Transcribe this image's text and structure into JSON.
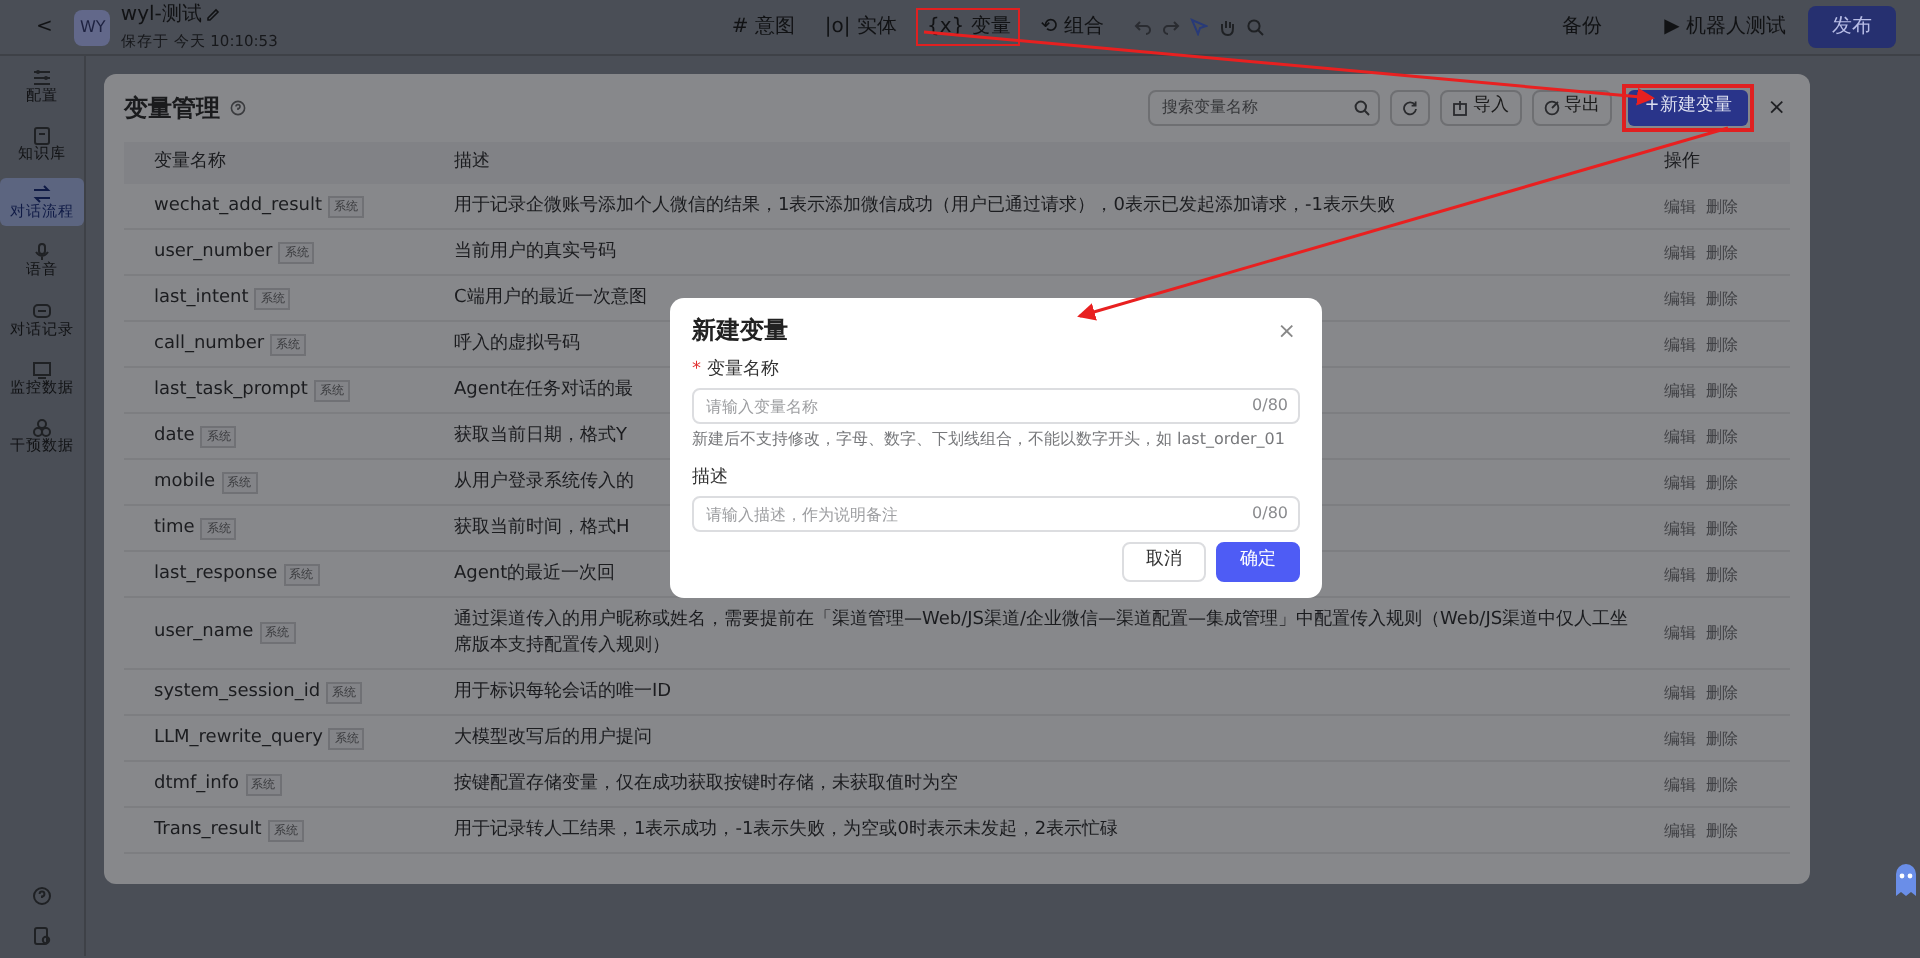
{
  "topbar": {
    "back": "<",
    "avatar": "WY",
    "project": "wyl-测试",
    "saved": "保存于 今天 10:10:53",
    "nav": [
      {
        "label": "意图",
        "icon": "#",
        "highlighted": false
      },
      {
        "label": "实体",
        "icon": "|o|",
        "highlighted": false
      },
      {
        "label": "变量",
        "icon": "{x}",
        "highlighted": true
      },
      {
        "label": "组合",
        "icon": "⟲",
        "highlighted": false
      }
    ],
    "actions": [
      {
        "label": "备份",
        "kind": "plain"
      },
      {
        "label": "机器人测试",
        "kind": "play",
        "icon": "▶"
      },
      {
        "label": "发布",
        "kind": "primary"
      }
    ]
  },
  "sidebar": [
    {
      "label": "配置",
      "selected": false
    },
    {
      "label": "知识库",
      "selected": false
    },
    {
      "label": "对话流程",
      "selected": true
    },
    {
      "label": "语音",
      "selected": false
    },
    {
      "label": "对话记录",
      "selected": false
    },
    {
      "label": "监控数据",
      "selected": false
    },
    {
      "label": "干预数据",
      "selected": false
    }
  ],
  "panel": {
    "title": "变量管理",
    "search": {
      "placeholder": "搜索变量名称"
    },
    "import": "导入",
    "export": "导出",
    "new_button": {
      "label": "+新建变量",
      "highlighted": true
    },
    "close": "×",
    "columns": [
      "变量名称",
      "描述",
      "操作"
    ],
    "rows": [
      {
        "name": "wechat_add_result",
        "tag": "系统",
        "desc": "用于记录企微账号添加个人微信的结果，1表示添加微信成功（用户已通过请求），0表示已发起添加请求，-1表示失败",
        "ops": [
          "编辑",
          "删除"
        ]
      },
      {
        "name": "user_number",
        "tag": "系统",
        "desc": "当前用户的真实号码",
        "ops": [
          "编辑",
          "删除"
        ]
      },
      {
        "name": "last_intent",
        "tag": "系统",
        "desc": "C端用户的最近一次意图",
        "ops": [
          "编辑",
          "删除"
        ]
      },
      {
        "name": "call_number",
        "tag": "系统",
        "desc": "呼入的虚拟号码",
        "ops": [
          "编辑",
          "删除"
        ]
      },
      {
        "name": "last_task_prompt",
        "tag": "系统",
        "desc": "Agent在任务对话的最",
        "ops": [
          "编辑",
          "删除"
        ]
      },
      {
        "name": "date",
        "tag": "系统",
        "desc": "获取当前日期，格式Y",
        "ops": [
          "编辑",
          "删除"
        ]
      },
      {
        "name": "mobile",
        "tag": "系统",
        "desc": "从用户登录系统传入的",
        "ops": [
          "编辑",
          "删除"
        ]
      },
      {
        "name": "time",
        "tag": "系统",
        "desc": "获取当前时间，格式H",
        "ops": [
          "编辑",
          "删除"
        ]
      },
      {
        "name": "last_response",
        "tag": "系统",
        "desc": "Agent的最近一次回",
        "ops": [
          "编辑",
          "删除"
        ]
      },
      {
        "name": "user_name",
        "tag": "系统",
        "desc": "通过渠道传入的用户昵称或姓名，需要提前在「渠道管理—Web/JS渠道/企业微信—渠道配置—集成管理」中配置传入规则（Web/JS渠道中仅人工坐席版本支持配置传入规则）",
        "ops": [
          "编辑",
          "删除"
        ]
      },
      {
        "name": "system_session_id",
        "tag": "系统",
        "desc": "用于标识每轮会话的唯一ID",
        "ops": [
          "编辑",
          "删除"
        ]
      },
      {
        "name": "LLM_rewrite_query",
        "tag": "系统",
        "desc": "大模型改写后的用户提问",
        "ops": [
          "编辑",
          "删除"
        ]
      },
      {
        "name": "dtmf_info",
        "tag": "系统",
        "desc": "按键配置存储变量，仅在成功获取按键时存储，未获取值时为空",
        "ops": [
          "编辑",
          "删除"
        ]
      },
      {
        "name": "Trans_result",
        "tag": "系统",
        "desc": "用于记录转人工结果，1表示成功，-1表示失败，为空或0时表示未发起，2表示忙碌",
        "ops": [
          "编辑",
          "删除"
        ]
      }
    ]
  },
  "dialog": {
    "title": "新建变量",
    "close": "×",
    "fields": [
      {
        "label": "变量名称",
        "required_mark": "*",
        "placeholder": "请输入变量名称",
        "counter": "0/80",
        "hint": "新建后不支持修改，字母、数字、下划线组合，不能以数字开头，如 last_order_01"
      },
      {
        "label": "描述",
        "placeholder": "请输入描述，作为说明备注",
        "counter": "0/80"
      }
    ],
    "buttons": [
      {
        "label": "取消",
        "kind": "secondary"
      },
      {
        "label": "确定",
        "kind": "primary"
      }
    ]
  },
  "annotation_arrows": [
    {
      "kind": "arrow"
    },
    {
      "kind": "arrow"
    }
  ]
}
